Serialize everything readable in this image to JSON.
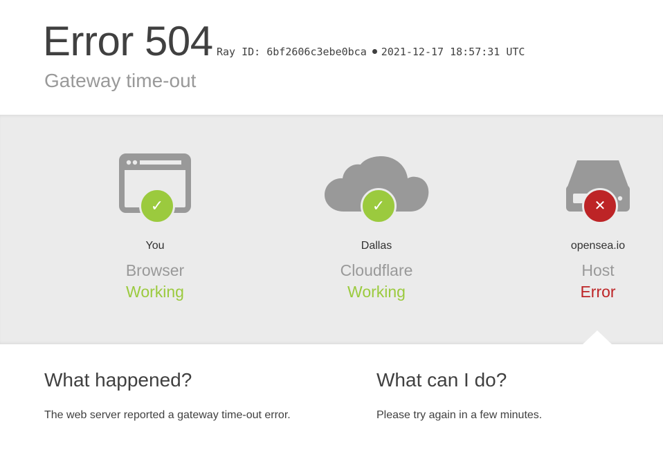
{
  "header": {
    "title": "Error 504",
    "ray_id_label": "Ray ID: 6bf2606c3ebe0bca",
    "timestamp": "2021-12-17 18:57:31 UTC",
    "subtitle": "Gateway time-out"
  },
  "nodes": [
    {
      "location": "You",
      "role": "Browser",
      "state": "Working",
      "icon": "browser-window-icon",
      "badge": "checkmark-icon",
      "status_color": "#9bca3e"
    },
    {
      "location": "Dallas",
      "role": "Cloudflare",
      "state": "Working",
      "icon": "cloud-icon",
      "badge": "checkmark-icon",
      "status_color": "#9bca3e"
    },
    {
      "location": "opensea.io",
      "role": "Host",
      "state": "Error",
      "icon": "server-drive-icon",
      "badge": "close-x-icon",
      "status_color": "#bd2426"
    }
  ],
  "badges": {
    "ok_glyph": "✓",
    "error_glyph": "✕"
  },
  "what_happened": {
    "heading": "What happened?",
    "body": "The web server reported a gateway time-out error."
  },
  "what_can_i_do": {
    "heading": "What can I do?",
    "body": "Please try again in a few minutes."
  },
  "colors": {
    "working": "#9bca3e",
    "error": "#bd2426",
    "muted_text": "#999999",
    "icon_gray": "#999999",
    "band_background": "#ebebeb"
  }
}
